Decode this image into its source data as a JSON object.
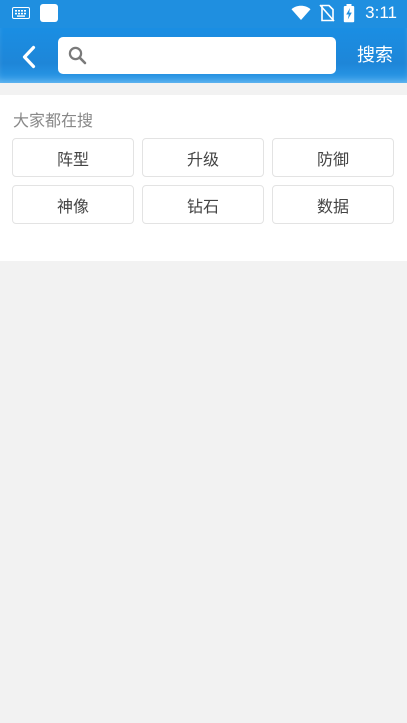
{
  "status_bar": {
    "time": "3:11",
    "icons": [
      "keyboard-icon",
      "app-square-icon",
      "wifi-icon",
      "no-sim-icon",
      "battery-charging-icon"
    ]
  },
  "header": {
    "back_icon": "chevron-left-icon",
    "search_placeholder": "",
    "search_value": "",
    "search_button_label": "搜索"
  },
  "hot_search": {
    "title": "大家都在搜",
    "tags": [
      {
        "label": "阵型"
      },
      {
        "label": "升级"
      },
      {
        "label": "防御"
      },
      {
        "label": "神像"
      },
      {
        "label": "钻石"
      },
      {
        "label": "数据"
      }
    ]
  },
  "colors": {
    "header_blue": "#1f8fe0",
    "page_background": "#f2f2f2",
    "panel_background": "#ffffff",
    "title_gray": "#888888"
  }
}
